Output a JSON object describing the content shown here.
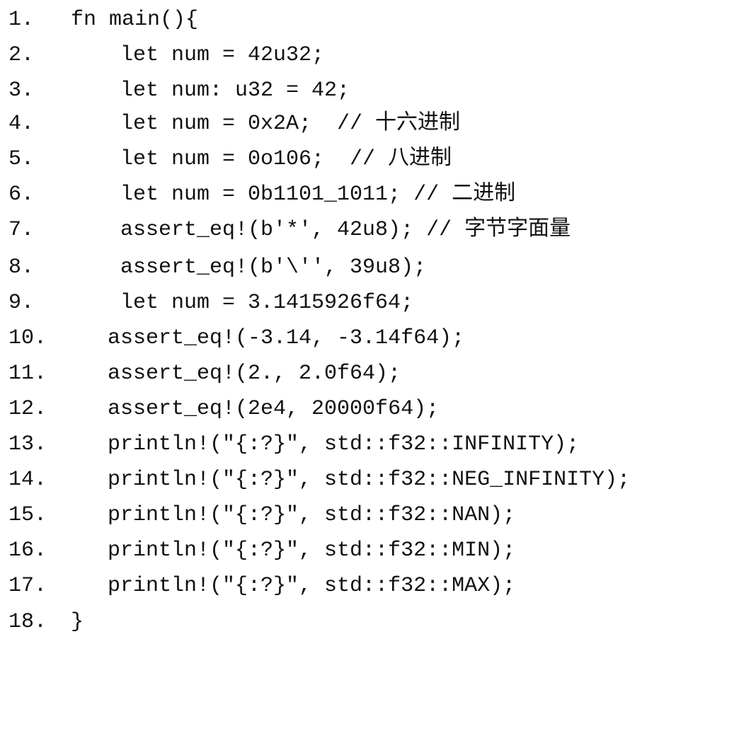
{
  "code": {
    "lines": [
      {
        "number": "1.",
        "text": "fn main(){"
      },
      {
        "number": "2.",
        "text": "let num = 42u32;"
      },
      {
        "number": "3.",
        "text": "let num: u32 = 42;"
      },
      {
        "number": "4.",
        "text": "let num = 0x2A;  // 十六进制"
      },
      {
        "number": "5.",
        "text": "let num = 0o106;  // 八进制"
      },
      {
        "number": "6.",
        "text": "let num = 0b1101_1011; // 二进制"
      },
      {
        "number": "7.",
        "text": "assert_eq!(b'*', 42u8); // 字节字面量"
      },
      {
        "number": "8.",
        "text": "assert_eq!(b'\\'', 39u8);"
      },
      {
        "number": "9.",
        "text": "let num = 3.1415926f64;"
      },
      {
        "number": "10.",
        "text": "assert_eq!(-3.14, -3.14f64);"
      },
      {
        "number": "11.",
        "text": "assert_eq!(2., 2.0f64);"
      },
      {
        "number": "12.",
        "text": "assert_eq!(2e4, 20000f64);"
      },
      {
        "number": "13.",
        "text": "println!(\"{:?}\", std::f32::INFINITY);"
      },
      {
        "number": "14.",
        "text": "println!(\"{:?}\", std::f32::NEG_INFINITY);"
      },
      {
        "number": "15.",
        "text": "println!(\"{:?}\", std::f32::NAN);"
      },
      {
        "number": "16.",
        "text": "println!(\"{:?}\", std::f32::MIN);"
      },
      {
        "number": "17.",
        "text": "println!(\"{:?}\", std::f32::MAX);"
      },
      {
        "number": "18.",
        "text": "}"
      }
    ]
  }
}
